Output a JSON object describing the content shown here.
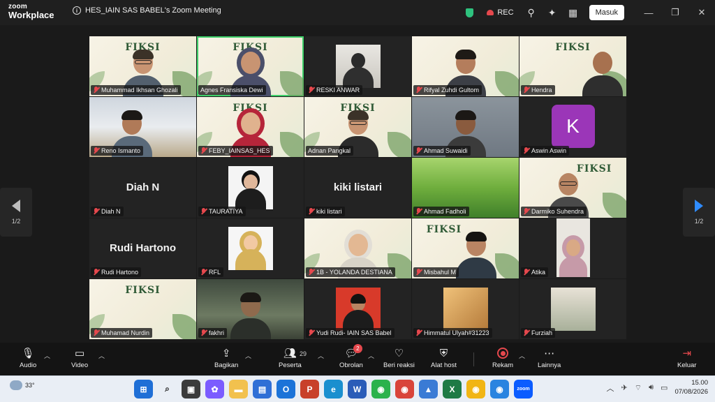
{
  "titlebar": {
    "brand_small": "zoom",
    "brand_large": "Workplace",
    "meeting_title": "HES_IAIN SAS BABEL's Zoom Meeting",
    "rec_label": "REC",
    "sign_in": "Masuk"
  },
  "gallery": {
    "page_left": "1/2",
    "page_right": "1/2",
    "poster_title": "FIKSI",
    "tiles": [
      {
        "name": "Muhammad Ikhsan Ghozali"
      },
      {
        "name": "Agnes Fransiska Dewi"
      },
      {
        "name": "RESKI ANWAR"
      },
      {
        "name": "Rifyal Zuhdi Gultom"
      },
      {
        "name": "Hendra"
      },
      {
        "name": "Reno Ismanto"
      },
      {
        "name": "FEBY_IAINSAS_HES"
      },
      {
        "name": "Adnan Pangkal"
      },
      {
        "name": "Ahmad Suwaidi"
      },
      {
        "name": "Aswin Aswin",
        "avatar": "K"
      },
      {
        "name": "Diah N",
        "big": "Diah N"
      },
      {
        "name": "TAURATIYA"
      },
      {
        "name": "kiki listari",
        "big": "kiki listari"
      },
      {
        "name": "Ahmad Fadholi"
      },
      {
        "name": "Darmiko Suhendra"
      },
      {
        "name": "Rudi Hartono",
        "big": "Rudi Hartono"
      },
      {
        "name": "RFL"
      },
      {
        "name": "1B - YOLANDA DESTIANA"
      },
      {
        "name": "Misbahul M"
      },
      {
        "name": "Atika"
      },
      {
        "name": "Muhamad Nurdin"
      },
      {
        "name": "fakhri"
      },
      {
        "name": "Yudi Rudi- IAIN SAS Babel"
      },
      {
        "name": "Himmatul Ulyah#31223"
      },
      {
        "name": "Furziah"
      }
    ]
  },
  "toolbar": {
    "audio": "Audio",
    "video": "Video",
    "share": "Bagikan",
    "participants": "Peserta",
    "participants_count": "29",
    "chat": "Obrolan",
    "chat_badge": "2",
    "react": "Beri reaksi",
    "host_tools": "Alat host",
    "record": "Rekam",
    "more": "Lainnya",
    "leave": "Keluar"
  },
  "taskbar": {
    "temperature": "33°",
    "time": "15.00",
    "date": "07/08/2026"
  },
  "colors": {
    "accent": "#2f8cff",
    "danger": "#e5484d",
    "speaking": "#3fd06a"
  }
}
